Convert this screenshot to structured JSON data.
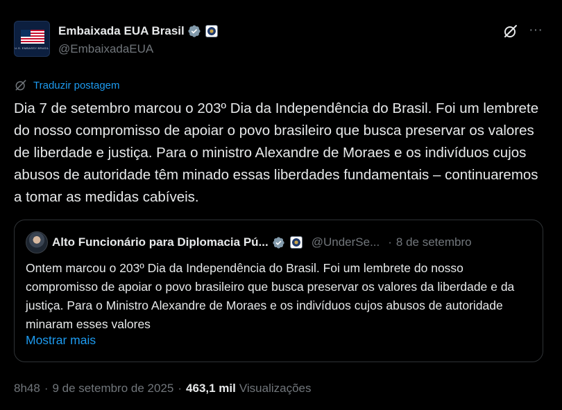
{
  "author": {
    "name": "Embaixada EUA Brasil",
    "handle": "@EmbaixadaEUA",
    "avatar_caption": "U.S. EMBASSY BRASIL",
    "avatar_icon": "us-flag-icon",
    "verified_icon": "verified-badge-icon",
    "affiliation_icon": "state-department-seal-icon"
  },
  "actions": {
    "grok_icon": "grok-icon",
    "more_icon": "more-options-icon",
    "more_glyph": "···"
  },
  "translate": {
    "icon": "translate-icon",
    "label": "Traduzir postagem"
  },
  "tweet": {
    "text": "Dia 7 de setembro marcou o 203º Dia da Independência do Brasil. Foi um lembrete do nosso compromisso de apoiar o povo brasileiro que busca preservar os valores de liberdade e justiça. Para o ministro Alexandre de Moraes e os indivíduos cujos abusos de autoridade têm minado essas liberdades fundamentais – continuaremos a tomar as medidas cabíveis."
  },
  "quote": {
    "name": "Alto Funcionário para Diplomacia Pú...",
    "handle": "@UnderSe...",
    "separator": "·",
    "date": "8 de setembro",
    "text": "Ontem marcou o 203º Dia da Independência do Brasil. Foi um lembrete do nosso compromisso de apoiar o povo brasileiro que busca preservar os valores da liberdade e da justiça. Para o Ministro Alexandre de Moraes e os indivíduos cujos abusos de autoridade minaram esses valores",
    "show_more": "Mostrar mais"
  },
  "meta": {
    "time": "8h48",
    "separator": "·",
    "date": "9 de setembro de 2025",
    "views_count": "463,1 mil",
    "views_label": "Visualizações"
  },
  "colors": {
    "background": "#000000",
    "text_primary": "#e7e9ea",
    "text_secondary": "#71767b",
    "accent": "#1d9bf0",
    "border": "#2f3336"
  }
}
